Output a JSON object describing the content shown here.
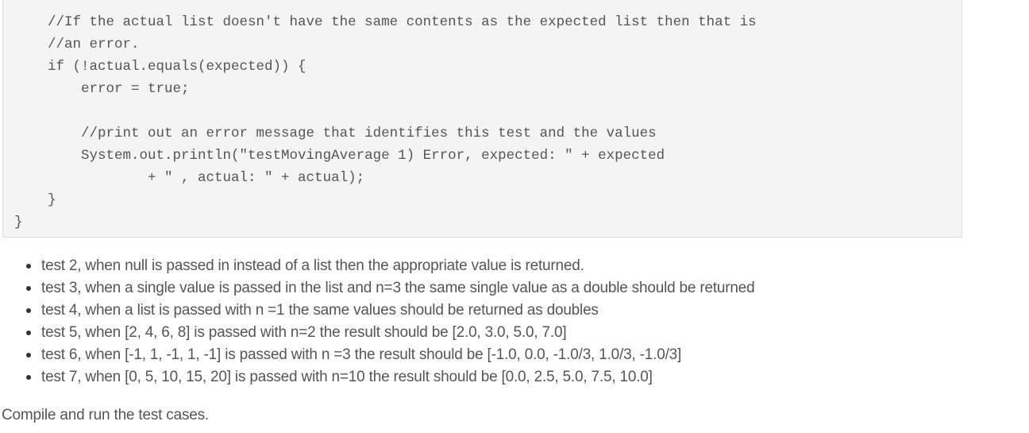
{
  "code_block": {
    "lines": [
      "    //If the actual list doesn't have the same contents as the expected list then that is",
      "    //an error.",
      "    if (!actual.equals(expected)) {",
      "        error = true;",
      "",
      "        //print out an error message that identifies this test and the values",
      "        System.out.println(\"testMovingAverage 1) Error, expected: \" + expected",
      "                + \" , actual: \" + actual);",
      "    }",
      "}"
    ]
  },
  "test_list": {
    "items": [
      "test 2, when null is passed in instead of a list then the appropriate value is returned.",
      "test 3, when a single value is passed in the list and n=3 the same single value as a double should be returned",
      "test 4, when a list is passed with n =1 the same values should be returned as doubles",
      "test 5, when [2, 4, 6, 8] is passed with n=2 the result should be [2.0, 3.0, 5.0, 7.0]",
      "test 6, when [-1, 1, -1, 1, -1] is passed with n =3 the result should be [-1.0, 0.0, -1.0/3, 1.0/3, -1.0/3]",
      "test 7, when [0, 5, 10, 15, 20] is passed with n=10 the result should be [0.0, 2.5, 5.0, 7.5, 10.0]"
    ]
  },
  "footer": {
    "instruction": "Compile and run the test cases."
  },
  "colors": {
    "code_background": "#f4f4f4",
    "code_border": "#dcdcdc",
    "text": "#555555"
  }
}
